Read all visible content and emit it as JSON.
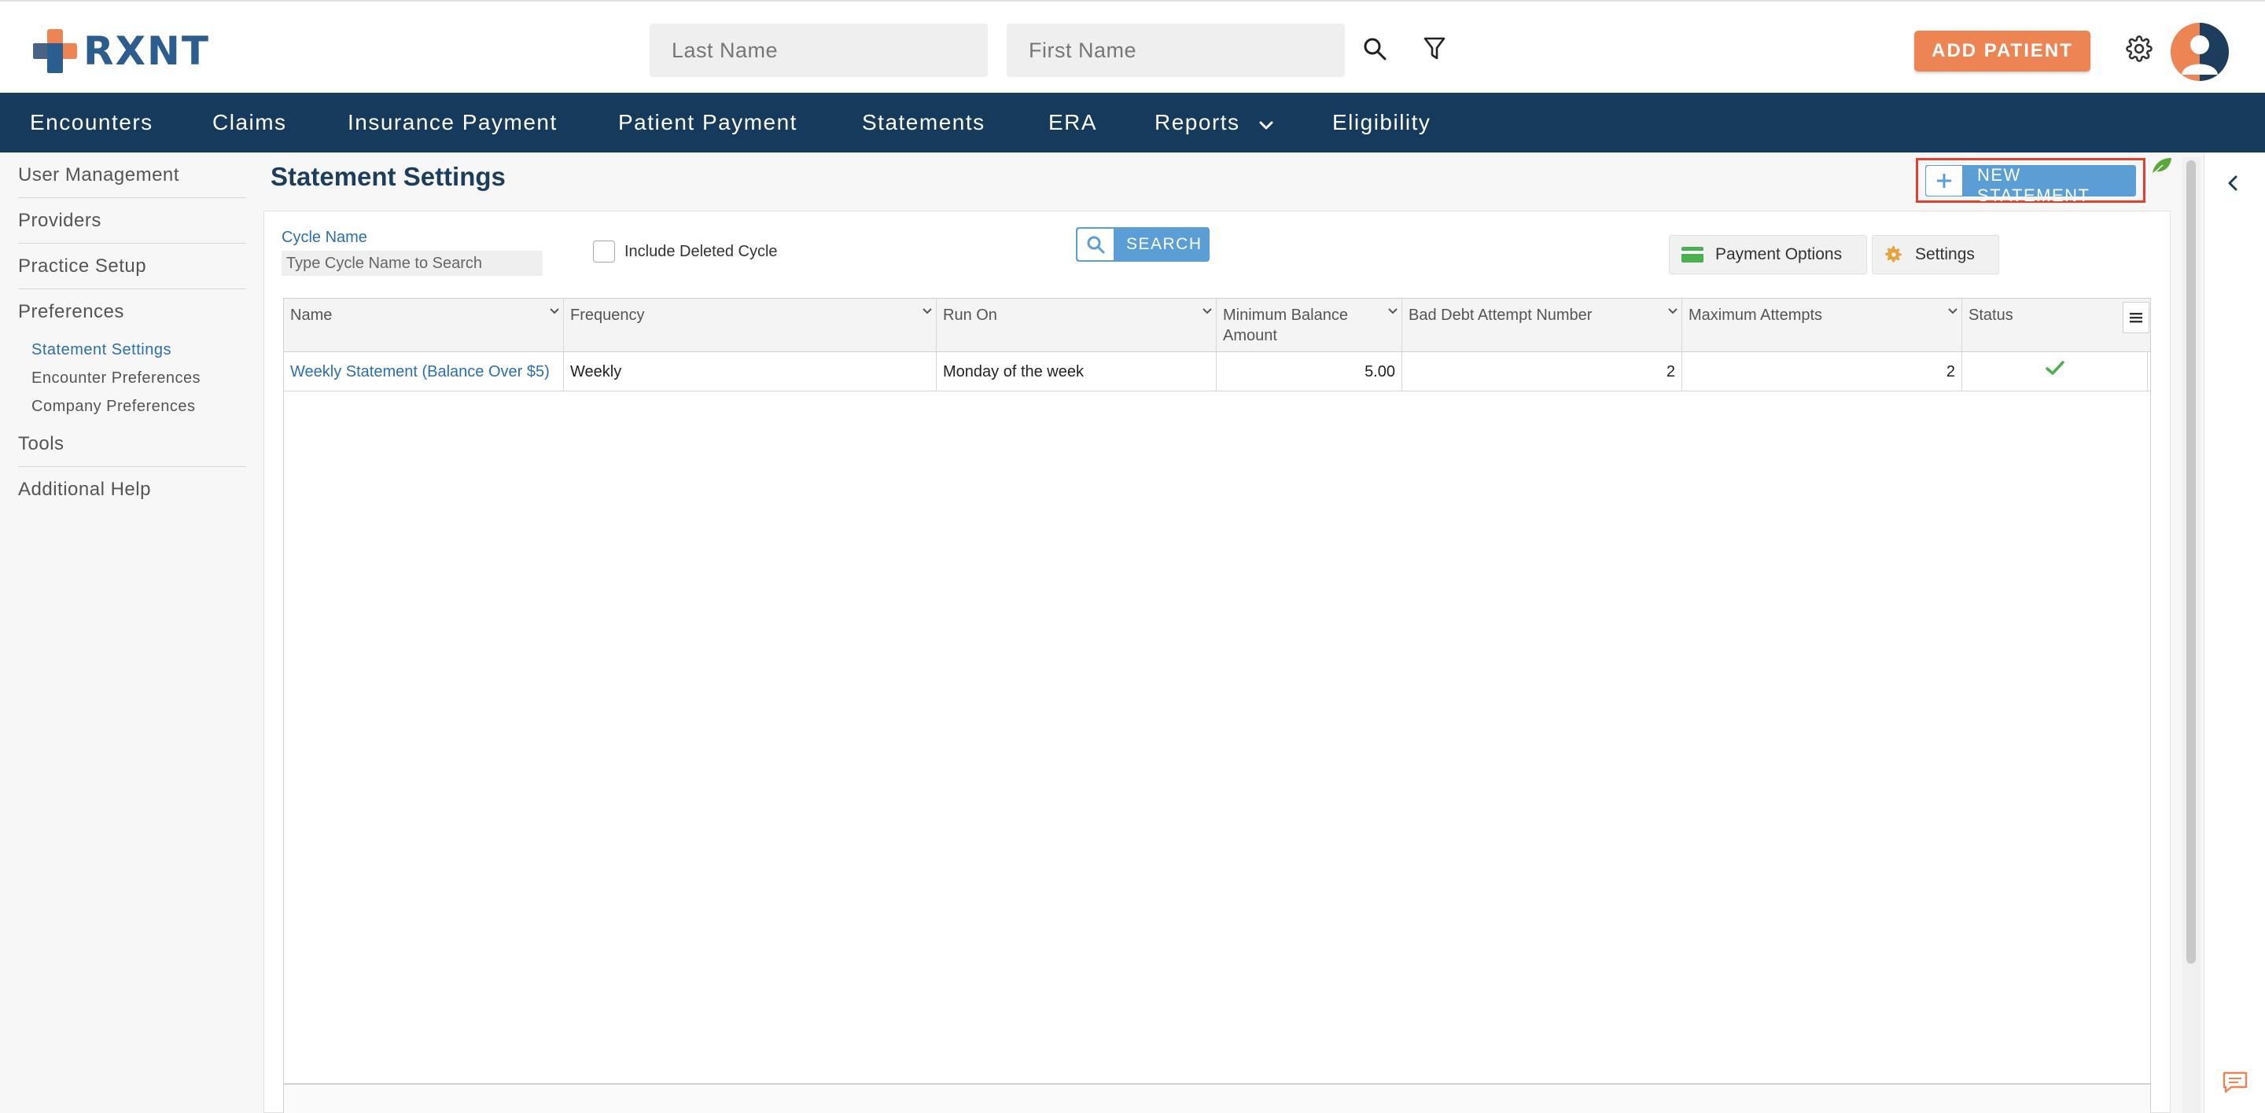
{
  "brand": {
    "name": "RXNT"
  },
  "header": {
    "last_name_placeholder": "Last Name",
    "first_name_placeholder": "First Name",
    "add_patient_label": "ADD PATIENT",
    "icons": [
      "search-icon",
      "filter-icon",
      "gear-icon",
      "avatar"
    ]
  },
  "nav": {
    "items": [
      "Encounters",
      "Claims",
      "Insurance Payment",
      "Patient Payment",
      "Statements",
      "ERA",
      "Reports",
      "Eligibility"
    ]
  },
  "sidebar": {
    "items": [
      "User Management",
      "Providers",
      "Practice Setup",
      "Preferences",
      "Tools",
      "Additional Help"
    ],
    "sub_items": [
      "Statement Settings",
      "Encounter Preferences",
      "Company Preferences"
    ],
    "active_sub_item": "Statement Settings"
  },
  "page": {
    "title": "Statement Settings",
    "new_statement_label": "NEW STATEMENT"
  },
  "filters": {
    "cycle_name_label": "Cycle Name",
    "cycle_name_placeholder": "Type Cycle Name to Search",
    "include_deleted_label": "Include Deleted Cycle",
    "include_deleted_checked": false,
    "search_label": "SEARCH",
    "payment_options_label": "Payment Options",
    "settings_label": "Settings"
  },
  "table": {
    "columns": [
      "Name",
      "Frequency",
      "Run On",
      "Minimum Balance Amount",
      "Bad Debt Attempt Number",
      "Maximum Attempts",
      "Status"
    ],
    "rows": [
      {
        "name": "Weekly Statement (Balance Over $5)",
        "frequency": "Weekly",
        "run_on": "Monday of the week",
        "minimum_balance": "5.00",
        "bad_debt_attempt": "2",
        "maximum_attempts": "2",
        "status": "check-icon"
      }
    ]
  },
  "colors": {
    "navbar": "#153a5c",
    "accent_orange": "#ec8453",
    "button_blue": "#5b9ed6",
    "link_blue": "#2c6fb0",
    "highlight_red": "#e2412f",
    "status_green": "#4caf50"
  }
}
